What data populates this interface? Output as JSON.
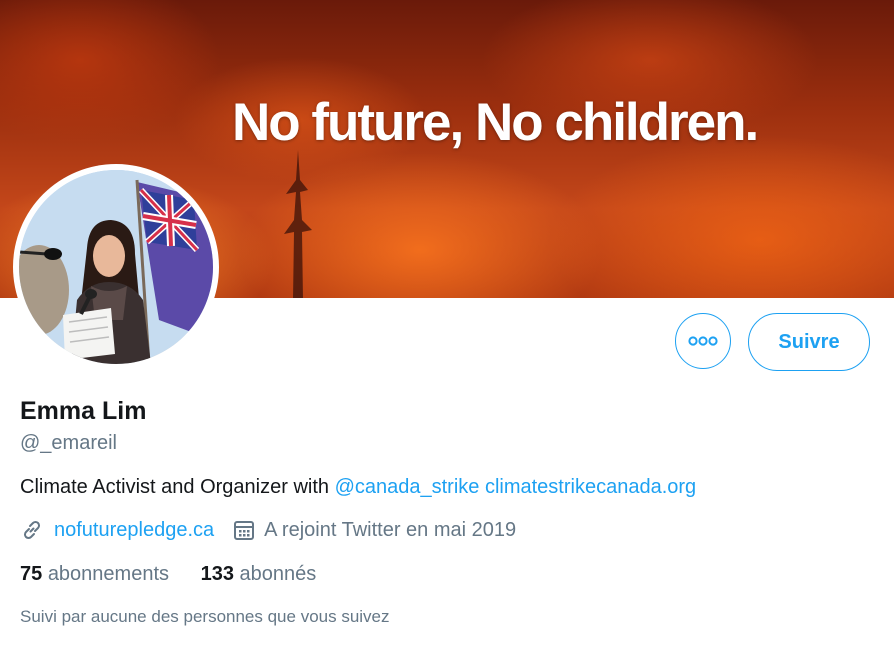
{
  "banner": {
    "text": "No future, No children."
  },
  "profile": {
    "name": "Emma Lim",
    "handle": "@_emareil",
    "bio_text": "Climate Activist and Organizer with ",
    "bio_mention": "@canada_strike",
    "bio_link": "climatestrikecanada.org",
    "website": "nofuturepledge.ca",
    "joined": "A rejoint Twitter en mai 2019"
  },
  "actions": {
    "more_icon": "more-horizontal-icon",
    "follow_label": "Suivre"
  },
  "stats": {
    "following_count": "75",
    "following_label": "abonnements",
    "followers_count": "133",
    "followers_label": "abonnés"
  },
  "followed_by": "Suivi par aucune des personnes que vous suivez",
  "colors": {
    "accent": "#1da1f2",
    "text_primary": "#14171a",
    "text_secondary": "#657786"
  }
}
